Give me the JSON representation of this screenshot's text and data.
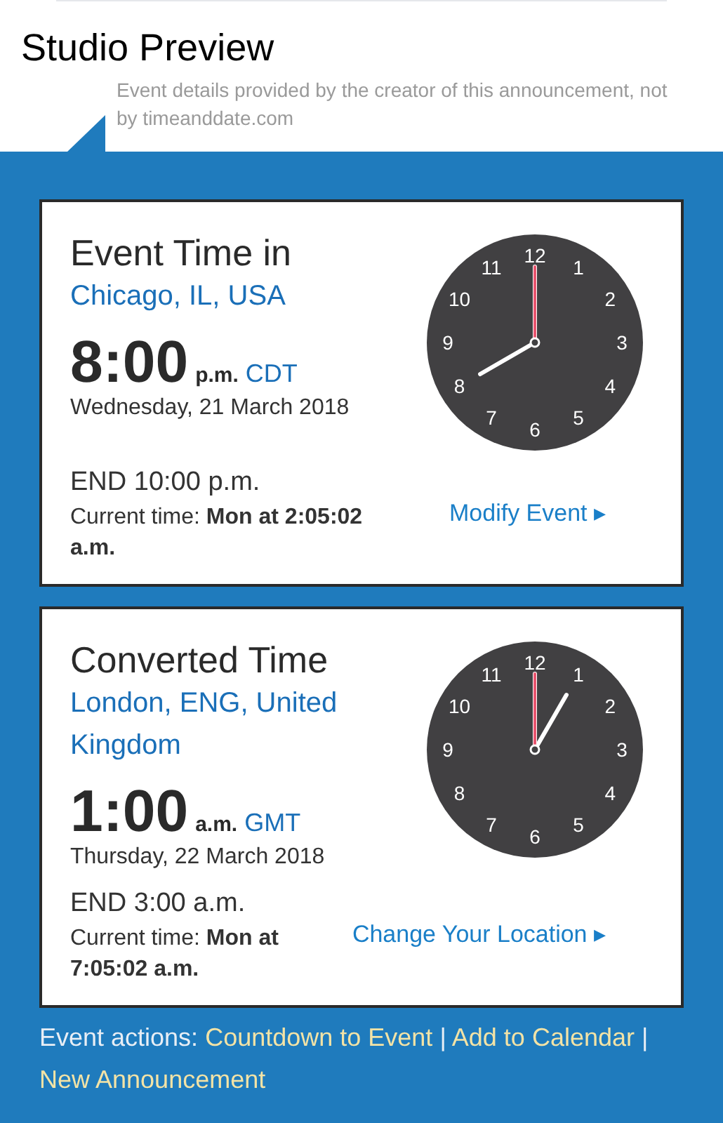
{
  "title": "Studio Preview",
  "note": "Event details provided by the creator of this announcement, not by timeanddate.com",
  "cards": [
    {
      "heading": "Event Time in",
      "location": "Chicago, IL, USA",
      "time": "8:00",
      "ampm": "p.m.",
      "zone": "CDT",
      "date": "Wednesday, 21 March 2018",
      "end": "END 10:00 p.m.",
      "current": "Current time: **Mon at 2:05:02 a.m.**",
      "link": "Modify Event ▸",
      "clock": {
        "numbers": [
          "12",
          "1",
          "2",
          "3",
          "4",
          "5",
          "6",
          "7",
          "8",
          "9",
          "10",
          "11"
        ]
      }
    },
    {
      "heading": "Converted Time",
      "location": "London, ENG, United Kingdom",
      "time": "1:00",
      "ampm": "a.m.",
      "zone": "GMT",
      "date": "Thursday, 22 March 2018",
      "end": "END 3:00 a.m.",
      "current": "Current time: **Mon at 7:05:02 a.m.**",
      "link": "Change Your Location ▸",
      "clock": {
        "numbers": [
          "12",
          "1",
          "2",
          "3",
          "4",
          "5",
          "6",
          "7",
          "8",
          "9",
          "10",
          "11"
        ]
      }
    }
  ],
  "actions": {
    "label": "Event actions:",
    "links": [
      "Countdown to Event",
      "Add to Calendar",
      "New Announcement"
    ],
    "separators": [
      "|",
      "|"
    ]
  }
}
